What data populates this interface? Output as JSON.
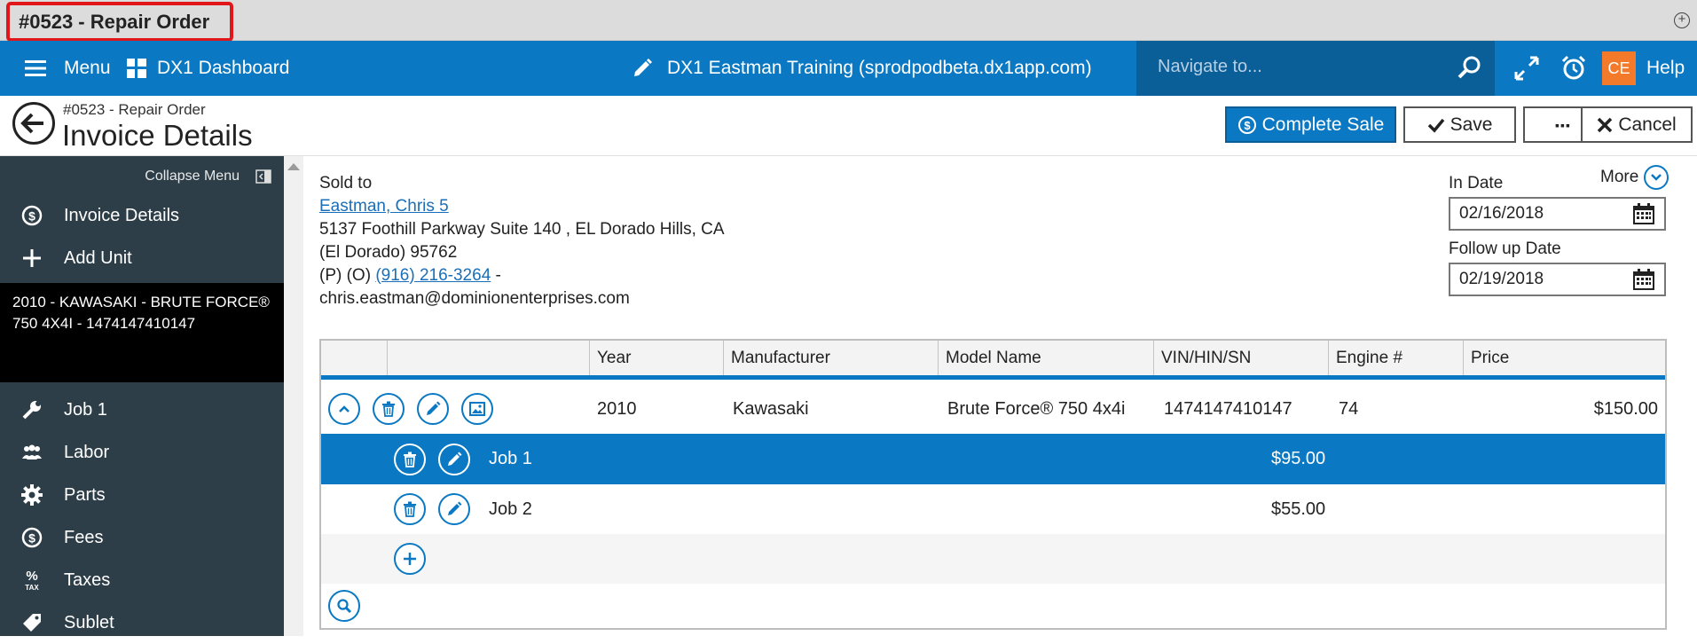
{
  "titlebar": {
    "title": "#0523 - Repair Order"
  },
  "topnav": {
    "menu_label": "Menu",
    "dashboard_label": "DX1 Dashboard",
    "site_label": "DX1 Eastman Training (sprodpodbeta.dx1app.com)",
    "navigate_placeholder": "Navigate to...",
    "user_initials": "CE",
    "help_label": "Help"
  },
  "header": {
    "subtitle": "#0523 - Repair Order",
    "title": "Invoice Details",
    "complete_sale": "Complete Sale",
    "save": "Save",
    "more_dots": "▪▪▪",
    "cancel": "Cancel"
  },
  "sidebar": {
    "collapse_label": "Collapse Menu",
    "items_top": [
      {
        "label": "Invoice Details",
        "icon": "dollar-circle-icon"
      },
      {
        "label": "Add Unit",
        "icon": "plus-icon"
      }
    ],
    "unit_text": "2010 - KAWASAKI - BRUTE FORCE® 750 4X4I - 1474147410147",
    "items_bottom": [
      {
        "label": "Job 1",
        "icon": "wrench-icon"
      },
      {
        "label": "Labor",
        "icon": "people-icon"
      },
      {
        "label": "Parts",
        "icon": "gear-icon"
      },
      {
        "label": "Fees",
        "icon": "dollar-circle-icon"
      },
      {
        "label": "Taxes",
        "icon": "percent-tax-icon"
      },
      {
        "label": "Sublet",
        "icon": "tag-icon"
      }
    ]
  },
  "customer": {
    "sold_to_label": "Sold to",
    "name": "Eastman, Chris 5",
    "address1": "5137 Foothill Parkway Suite 140 , EL Dorado Hills, CA",
    "address2": "(El Dorado) 95762",
    "phone_prefix": "(P) (O)",
    "phone": "(916) 216-3264",
    "phone_suffix": "-",
    "email": "chris.eastman@dominionenterprises.com"
  },
  "dates": {
    "more_label": "More",
    "in_date_label": "In Date",
    "in_date": "02/16/2018",
    "follow_up_label": "Follow up Date",
    "follow_up": "02/19/2018"
  },
  "grid": {
    "columns": [
      "Year",
      "Manufacturer",
      "Model Name",
      "VIN/HIN/SN",
      "Engine #",
      "Price"
    ],
    "unit_row": {
      "year": "2010",
      "manufacturer": "Kawasaki",
      "model": "Brute Force® 750 4x4i",
      "vin": "1474147410147",
      "engine": "74",
      "price": "$150.00"
    },
    "jobs": [
      {
        "name": "Job 1",
        "amount": "$95.00",
        "selected": true
      },
      {
        "name": "Job 2",
        "amount": "$55.00",
        "selected": false
      }
    ]
  },
  "colors": {
    "brand_blue": "#0a78c2",
    "sidebar_bg": "#2d3e48",
    "highlight": "#e0161b",
    "badge_orange": "#f27a2a"
  }
}
